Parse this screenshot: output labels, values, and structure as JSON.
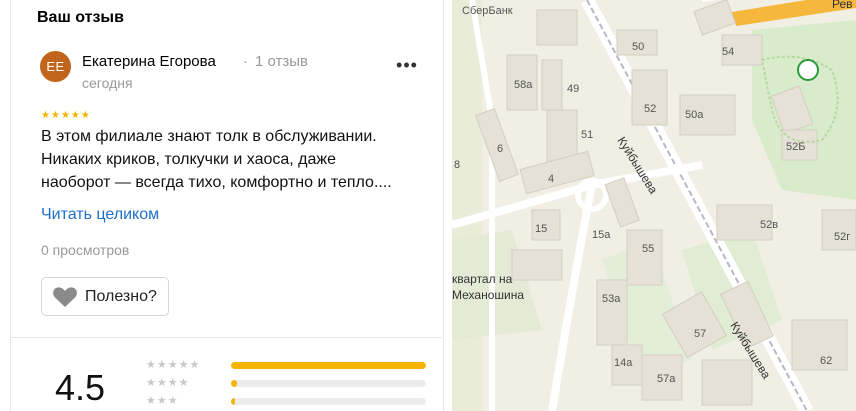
{
  "review_section": {
    "title": "Ваш отзыв",
    "author": {
      "initials": "ЕЕ",
      "name": "Екатерина Егорова",
      "separator": "·",
      "review_count": "1 отзыв",
      "date": "сегодня",
      "avatar_color": "#c0651b"
    },
    "rating_stars": 5,
    "text_lines": [
      "В этом филиале знают толк в обслуживании.",
      "Никаких криков, толкучки и хаоса, даже",
      "наоборот — всегда тихо, комфортно и тепло...."
    ],
    "read_more": "Читать целиком",
    "views": "0 просмотров",
    "useful_button": "Полезно?",
    "menu_icon": "more-horizontal-icon"
  },
  "rating_summary": {
    "score": "4.5",
    "distribution": [
      {
        "stars": 5,
        "fraction": 1.0
      },
      {
        "stars": 4,
        "fraction": 0.03
      },
      {
        "stars": 3,
        "fraction": 0.02
      }
    ],
    "accent_color": "#f5b400"
  },
  "map": {
    "poi_labels": [
      "СберБанк"
    ],
    "street_labels": [
      "Куйбышева",
      "Куйбышева",
      "Рев"
    ],
    "quarter_label_lines": [
      "квартал на",
      "Механошина"
    ],
    "building_numbers": [
      "50",
      "54",
      "58а",
      "49",
      "52",
      "50а",
      "52Б",
      "6",
      "51",
      "8",
      "4",
      "52в",
      "52г",
      "15",
      "15а",
      "55",
      "53а",
      "57",
      "62",
      "14а",
      "57а"
    ]
  }
}
